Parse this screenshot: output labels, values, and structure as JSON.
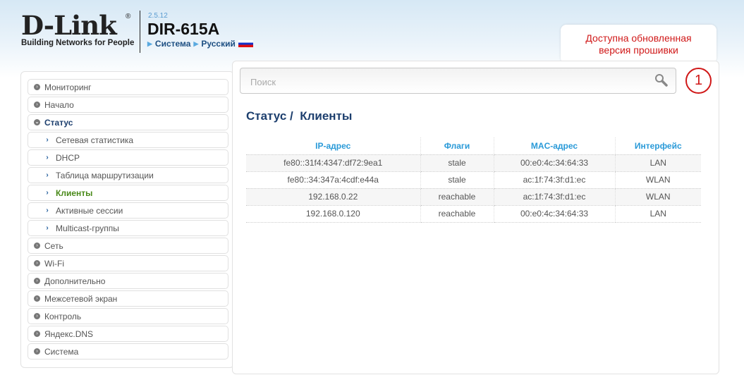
{
  "header": {
    "logo_text": "D-Link",
    "logo_tagline": "Building Networks for People",
    "version": "2.5.12",
    "model": "DIR-615A",
    "crumb_system": "Система",
    "crumb_language": "Русский"
  },
  "notification": {
    "text_line1": "Доступна обновленная",
    "text_line2": "версия прошивки",
    "count": "1"
  },
  "search": {
    "placeholder": "Поиск"
  },
  "sidebar": {
    "items": [
      {
        "label": "Мониторинг"
      },
      {
        "label": "Начало"
      },
      {
        "label": "Статус"
      },
      {
        "label": "Сетевая статистика"
      },
      {
        "label": "DHCP"
      },
      {
        "label": "Таблица маршрутизации"
      },
      {
        "label": "Клиенты"
      },
      {
        "label": "Активные сессии"
      },
      {
        "label": "Multicast-группы"
      },
      {
        "label": "Сеть"
      },
      {
        "label": "Wi-Fi"
      },
      {
        "label": "Дополнительно"
      },
      {
        "label": "Межсетевой экран"
      },
      {
        "label": "Контроль"
      },
      {
        "label": "Яндекс.DNS"
      },
      {
        "label": "Система"
      }
    ]
  },
  "page": {
    "title_section": "Статус /",
    "title_page": "Клиенты"
  },
  "table": {
    "headers": [
      "IP-адрес",
      "Флаги",
      "MAC-адрес",
      "Интерфейс"
    ],
    "rows": [
      [
        "fe80::31f4:4347:df72:9ea1",
        "stale",
        "00:e0:4c:34:64:33",
        "LAN"
      ],
      [
        "fe80::34:347a:4cdf:e44a",
        "stale",
        "ac:1f:74:3f:d1:ec",
        "WLAN"
      ],
      [
        "192.168.0.22",
        "reachable",
        "ac:1f:74:3f:d1:ec",
        "WLAN"
      ],
      [
        "192.168.0.120",
        "reachable",
        "00:e0:4c:34:64:33",
        "LAN"
      ]
    ]
  }
}
